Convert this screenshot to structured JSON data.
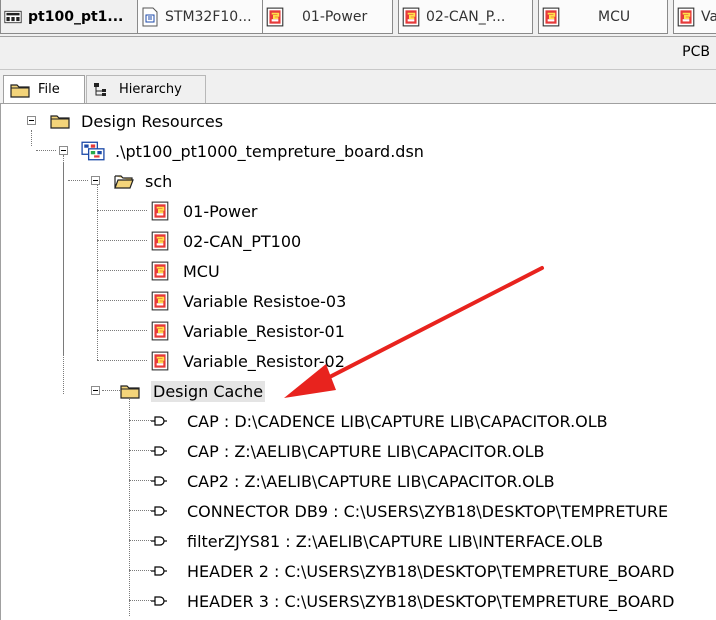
{
  "tabs": [
    {
      "label": "pt100_pt1...",
      "icon": "schematic-doc-icon",
      "active": true
    },
    {
      "label": "STM32F10...",
      "icon": "page-icon",
      "active": false
    },
    {
      "label": "01-Power",
      "icon": "schematic-page-icon",
      "active": false
    },
    {
      "label": "02-CAN_P...",
      "icon": "schematic-page-icon",
      "active": false
    },
    {
      "label": "MCU",
      "icon": "schematic-page-icon",
      "active": false
    },
    {
      "label": "Va",
      "icon": "schematic-page-icon",
      "active": false
    }
  ],
  "toolbar": {
    "pcb_label": "PCB"
  },
  "panel_tabs": {
    "file": "File",
    "hierarchy": "Hierarchy"
  },
  "tree": {
    "root": "Design Resources",
    "design_file": ".\\pt100_pt1000_tempreture_board.dsn",
    "sch_folder": "sch",
    "pages": [
      "01-Power",
      "02-CAN_PT100",
      "MCU",
      "Variable Resistoe-03",
      "Variable_Resistor-01",
      "Variable_Resistor-02"
    ],
    "cache_folder": "Design Cache",
    "cache_items": [
      "CAP : D:\\CADENCE LIB\\CAPTURE LIB\\CAPACITOR.OLB",
      "CAP : Z:\\AELIB\\CAPTURE LIB\\CAPACITOR.OLB",
      "CAP2 : Z:\\AELIB\\CAPTURE LIB\\CAPACITOR.OLB",
      "CONNECTOR DB9 : C:\\USERS\\ZYB18\\DESKTOP\\TEMPRETURE",
      "filterZJYS81 : Z:\\AELIB\\CAPTURE LIB\\INTERFACE.OLB",
      "HEADER 2 : C:\\USERS\\ZYB18\\DESKTOP\\TEMPRETURE_BOARD",
      "HEADER 3 : C:\\USERS\\ZYB18\\DESKTOP\\TEMPRETURE_BOARD"
    ]
  },
  "annotation": {
    "arrow_color": "#e8231e",
    "target": "Design Cache"
  },
  "colors": {
    "arrow": "#e8231e",
    "selection": "#e4e4e4",
    "folder_fill": "#f3d47a"
  }
}
